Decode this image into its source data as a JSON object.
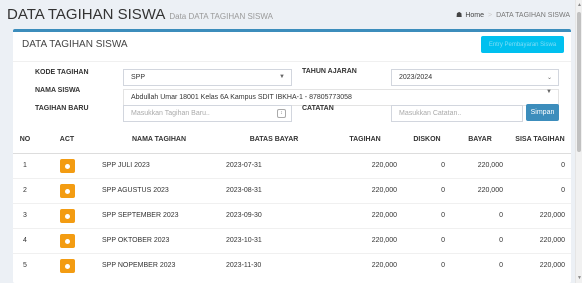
{
  "header": {
    "title": "DATA TAGIHAN SISWA",
    "subtitle": "Data DATA TAGIHAN SISWA",
    "breadcrumb": {
      "home": "Home",
      "current": "DATA TAGIHAN SISWA"
    }
  },
  "box": {
    "title": "DATA TAGIHAN SISWA",
    "top_button": "Entry Pembayaran Siswa"
  },
  "form": {
    "kode_tagihan_label": "KODE TAGIHAN",
    "kode_tagihan_value": "SPP",
    "tahun_ajaran_label": "TAHUN AJARAN",
    "tahun_ajaran_value": "2023/2024",
    "nama_siswa_label": "NAMA SISWA",
    "nama_siswa_value": "Abdullah Umar 18001 Kelas 6A Kampus SDIT IBKHA-1 - 87805773058",
    "tagihan_baru_label": "TAGIHAN BARU",
    "tagihan_baru_placeholder": "Masukkan Tagihan Baru..",
    "catatan_label": "CATATAN",
    "catatan_placeholder": "Masukkan Catatan..",
    "save_label": "Simpan"
  },
  "table": {
    "columns": [
      "NO",
      "ACT",
      "NAMA TAGIHAN",
      "BATAS BAYAR",
      "TAGIHAN",
      "DISKON",
      "BAYAR",
      "SISA TAGIHAN"
    ],
    "rows": [
      {
        "no": "1",
        "nama": "SPP JULI 2023",
        "batas": "2023-07-31",
        "tagihan": "220,000",
        "diskon": "0",
        "bayar": "220,000",
        "sisa": "0"
      },
      {
        "no": "2",
        "nama": "SPP AGUSTUS 2023",
        "batas": "2023-08-31",
        "tagihan": "220,000",
        "diskon": "0",
        "bayar": "220,000",
        "sisa": "0"
      },
      {
        "no": "3",
        "nama": "SPP SEPTEMBER 2023",
        "batas": "2023-09-30",
        "tagihan": "220,000",
        "diskon": "0",
        "bayar": "0",
        "sisa": "220,000"
      },
      {
        "no": "4",
        "nama": "SPP OKTOBER 2023",
        "batas": "2023-10-31",
        "tagihan": "220,000",
        "diskon": "0",
        "bayar": "0",
        "sisa": "220,000"
      },
      {
        "no": "5",
        "nama": "SPP NOPEMBER 2023",
        "batas": "2023-11-30",
        "tagihan": "220,000",
        "diskon": "0",
        "bayar": "0",
        "sisa": "220,000"
      }
    ]
  },
  "icons": {
    "home": "home-icon",
    "dropdown": "chevron-down-icon",
    "spinner": "spinner-icon",
    "action": "settings-icon"
  },
  "colors": {
    "primary": "#3c8dbc",
    "info": "#00c0ef",
    "warning": "#f39c12",
    "background": "#ecf0f5"
  }
}
